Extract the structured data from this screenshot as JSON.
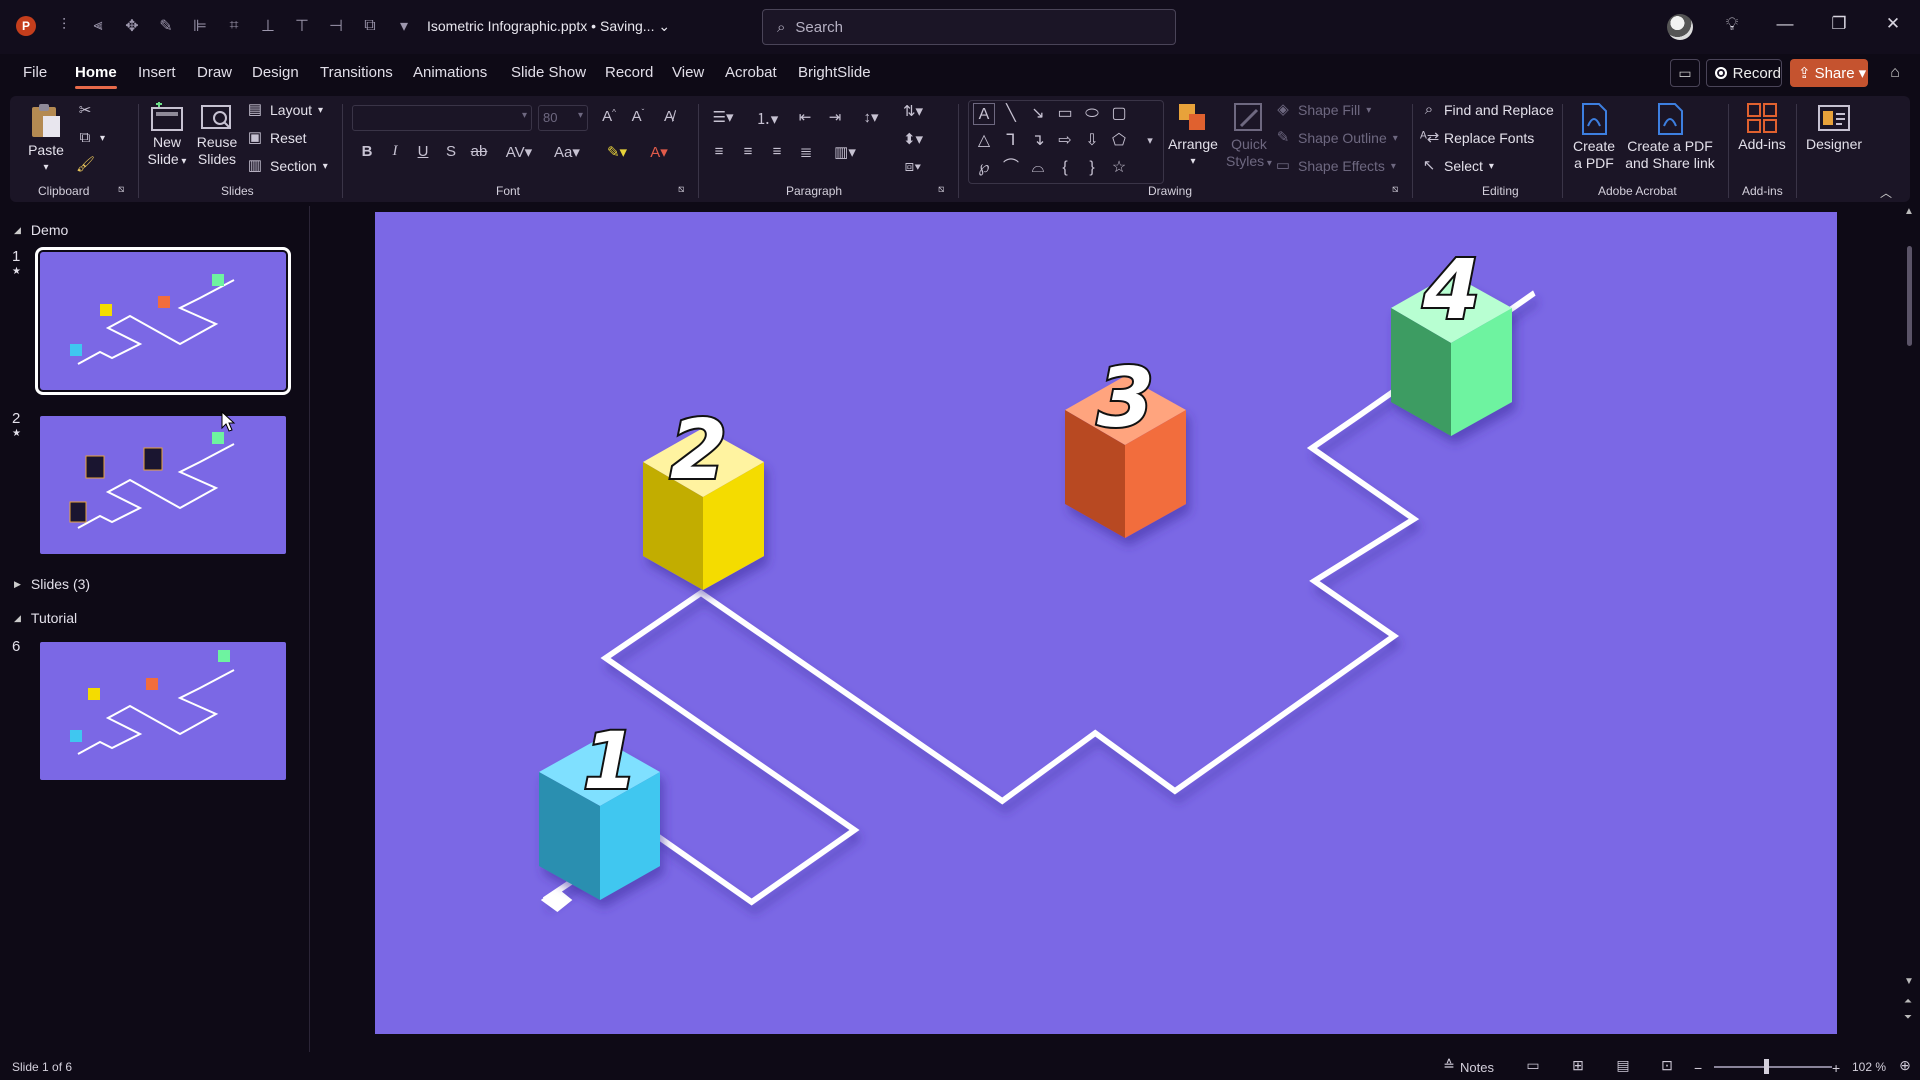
{
  "titlebar": {
    "app_logo": "P",
    "doc_title": "Isometric Infographic.pptx • Saving...",
    "search_placeholder": "Search"
  },
  "tabs": [
    "File",
    "Home",
    "Insert",
    "Draw",
    "Design",
    "Transitions",
    "Animations",
    "Slide Show",
    "Record",
    "View",
    "Acrobat",
    "BrightSlide"
  ],
  "active_tab": "Home",
  "actions": {
    "record": "Record",
    "share": "Share"
  },
  "ribbon": {
    "clipboard": {
      "label": "Clipboard",
      "paste": "Paste"
    },
    "slides": {
      "label": "Slides",
      "new_slide_1": "New",
      "new_slide_2": "Slide",
      "reuse_1": "Reuse",
      "reuse_2": "Slides",
      "layout": "Layout",
      "reset": "Reset",
      "section": "Section"
    },
    "font": {
      "label": "Font",
      "size": "80"
    },
    "paragraph": {
      "label": "Paragraph"
    },
    "drawing": {
      "label": "Drawing",
      "arrange": "Arrange",
      "quick_1": "Quick",
      "quick_2": "Styles",
      "shape_fill": "Shape Fill",
      "shape_outline": "Shape Outline",
      "shape_effects": "Shape Effects"
    },
    "editing": {
      "label": "Editing",
      "find_replace": "Find and Replace",
      "replace_fonts": "Replace Fonts",
      "select": "Select"
    },
    "acrobat": {
      "label": "Adobe Acrobat",
      "create_pdf_1": "Create",
      "create_pdf_2": "a PDF",
      "share_pdf_1": "Create a PDF",
      "share_pdf_2": "and Share link"
    },
    "addins": {
      "label": "Add-ins",
      "addins": "Add-ins"
    },
    "designer": {
      "designer": "Designer"
    }
  },
  "panel": {
    "sections": [
      {
        "name": "Demo"
      },
      {
        "name": "Slides (3)"
      },
      {
        "name": "Tutorial"
      }
    ],
    "slide_numbers": [
      "1",
      "2",
      "6"
    ]
  },
  "slide": {
    "labels": [
      "1",
      "2",
      "3",
      "4"
    ],
    "colors": {
      "background": "#7b68e5",
      "cube1": "#3fc7f0",
      "cube2": "#f4dc00",
      "cube3": "#f26d3c",
      "cube4": "#6ef3a0"
    }
  },
  "statusbar": {
    "slide_info": "Slide 1 of 6",
    "notes": "Notes",
    "zoom": "102 %"
  }
}
